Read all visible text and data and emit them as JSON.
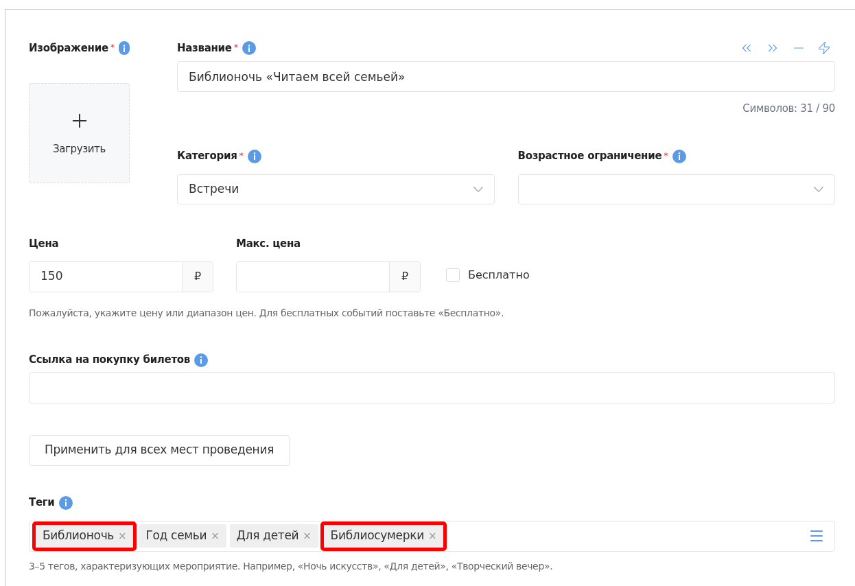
{
  "image": {
    "label": "Изображение",
    "mark": "*",
    "upload": "Загрузить"
  },
  "title": {
    "label": "Название",
    "mark": "*",
    "value": "Библионочь «Читаем всей семьей»",
    "counter": "Символов: 31 / 90"
  },
  "category": {
    "label": "Категория",
    "mark": "*",
    "value": "Встречи"
  },
  "age": {
    "label": "Возрастное ограничение",
    "mark": "*"
  },
  "price": {
    "label": "Цена",
    "value": "150",
    "currency": "₽"
  },
  "max_price": {
    "label": "Макс. цена",
    "currency": "₽"
  },
  "free": {
    "label": "Бесплатно",
    "checked": false
  },
  "price_hint": "Пожалуйста, укажите цену или диапазон цен. Для бесплатных событий поставьте «Бесплатно».",
  "ticket_link": {
    "label": "Ссылка на покупку билетов"
  },
  "apply_button": "Применить для всех мест проведения",
  "tags": {
    "label": "Теги",
    "items": [
      {
        "label": "Библионочь",
        "remove": "×",
        "highlighted": true
      },
      {
        "label": "Год семьи",
        "remove": "×",
        "highlighted": false
      },
      {
        "label": "Для детей",
        "remove": "×",
        "highlighted": false
      },
      {
        "label": "Библиосумерки",
        "remove": "×",
        "highlighted": true
      }
    ],
    "hint": "3–5 тегов, характеризующих мероприятие. Например, «Ночь искусств», «Для детей», «Творческий вечер»."
  }
}
